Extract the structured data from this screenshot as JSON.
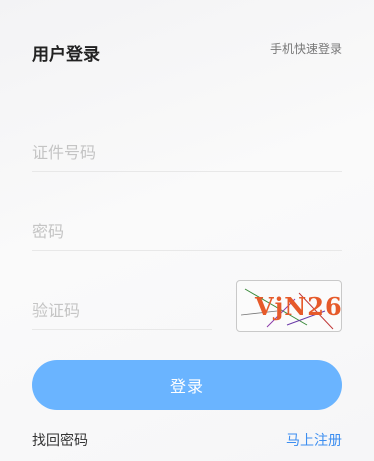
{
  "header": {
    "title": "用户登录",
    "phone_login": "手机快速登录"
  },
  "form": {
    "id_placeholder": "证件号码",
    "password_placeholder": "密码",
    "code_placeholder": "验证码",
    "captcha_text": "VjN26",
    "submit_label": "登录"
  },
  "footer": {
    "forgot": "找回密码",
    "register": "马上注册"
  },
  "colors": {
    "primary_button": "#6ab4ff",
    "link": "#3d8ef0",
    "captcha_text": "#e65a2a"
  }
}
